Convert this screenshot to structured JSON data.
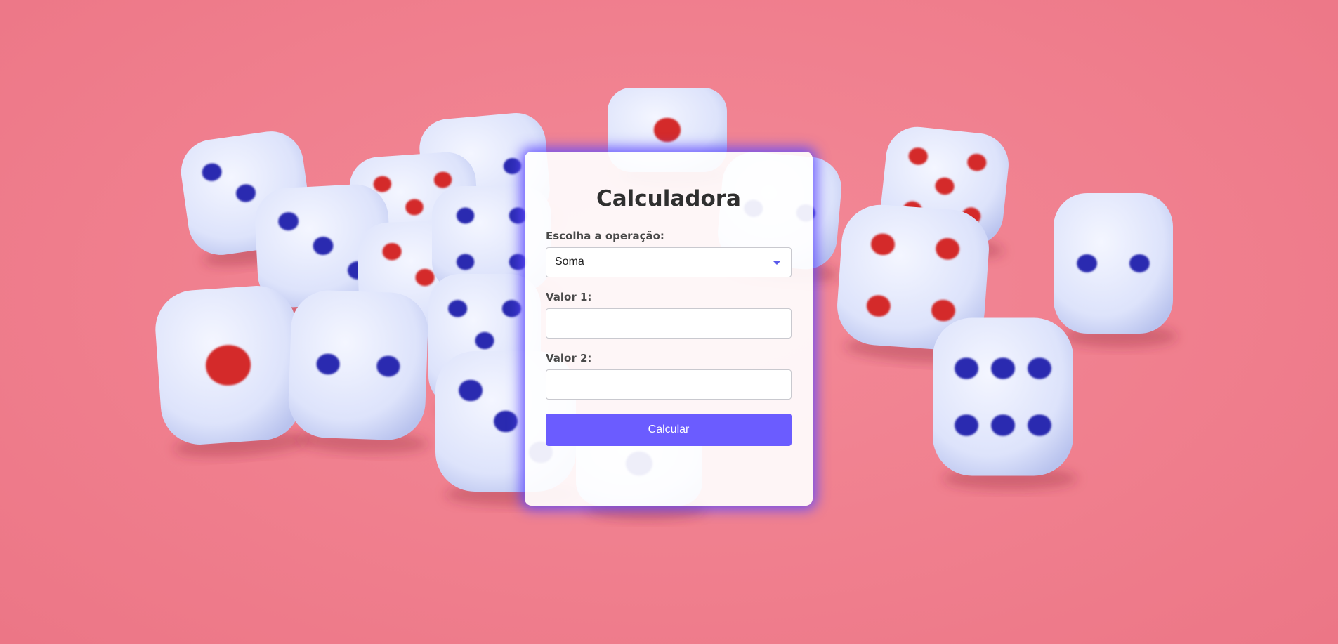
{
  "calculator": {
    "title": "Calculadora",
    "operation_label": "Escolha a operação:",
    "operation_selected": "Soma",
    "value1_label": "Valor 1:",
    "value1_input": "",
    "value2_label": "Valor 2:",
    "value2_input": "",
    "submit_label": "Calcular"
  },
  "colors": {
    "background": "#f07f8e",
    "accent": "#6b5cff",
    "glow": "#5c46ff",
    "die_face": "#e7ecff",
    "pip_blue": "#2b2bb0",
    "pip_red": "#d42a2a"
  },
  "icons": {
    "select_caret": "chevron-down-icon"
  }
}
